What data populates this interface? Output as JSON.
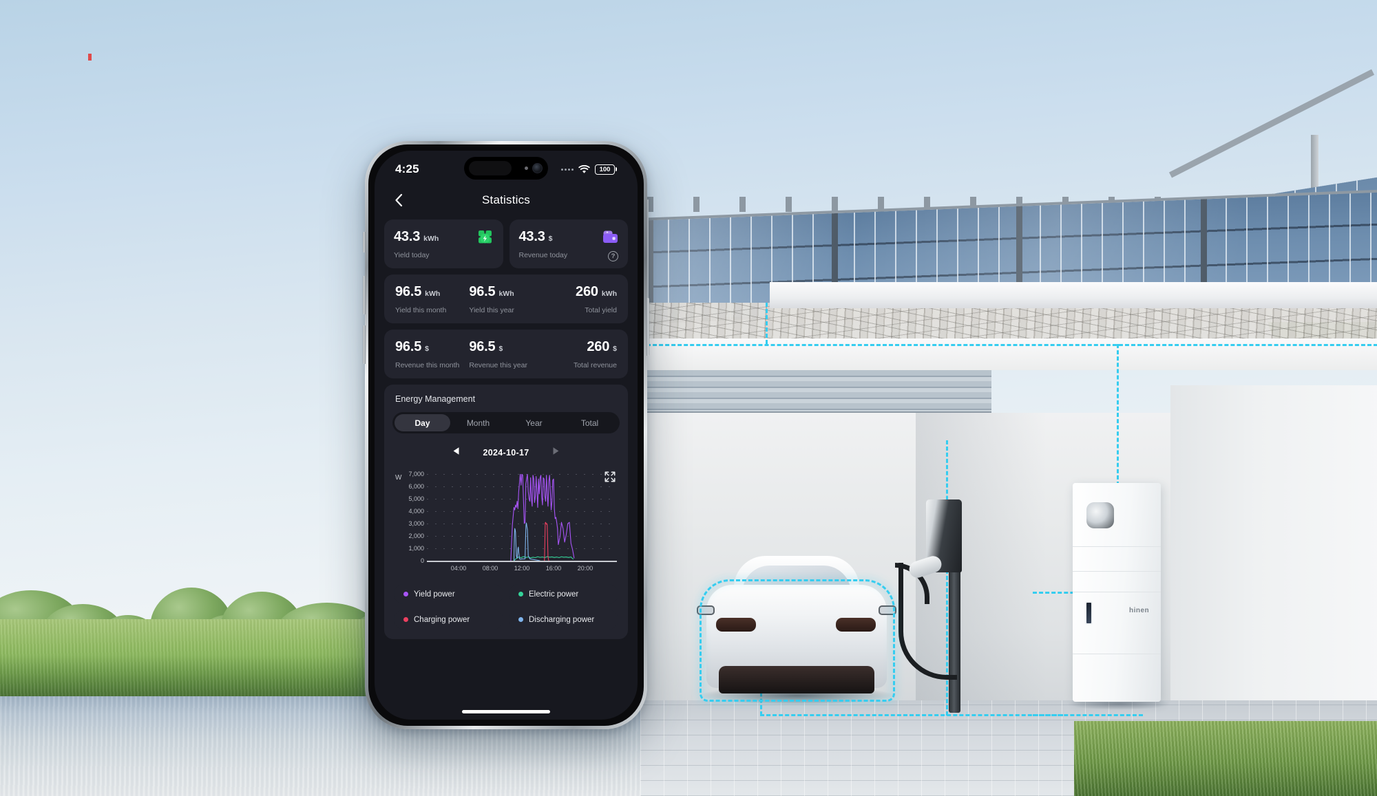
{
  "scene": {
    "battery_brand": "hinen"
  },
  "phone": {
    "statusbar": {
      "time": "4:25",
      "battery_level": "100",
      "wifi_icon": "wifi-icon",
      "signal_icon": "signal-dots-icon"
    },
    "nav": {
      "back_icon": "chevron-left-icon",
      "title": "Statistics"
    },
    "home_indicator": "home-indicator"
  },
  "stats": {
    "today": [
      {
        "value": "43.3",
        "unit": "kWh",
        "label": "Yield today",
        "icon": "solar-panel-icon",
        "icon_color": "#22c55e"
      },
      {
        "value": "43.3",
        "unit": "$",
        "label": "Revenue today",
        "icon": "wallet-icon",
        "icon_color": "#8b5cf6",
        "help": "?"
      }
    ],
    "yield_row": [
      {
        "value": "96.5",
        "unit": "kWh",
        "label": "Yield this month"
      },
      {
        "value": "96.5",
        "unit": "kWh",
        "label": "Yield this year"
      },
      {
        "value": "260",
        "unit": "kWh",
        "label": "Total yield"
      }
    ],
    "revenue_row": [
      {
        "value": "96.5",
        "unit": "$",
        "label": "Revenue this month"
      },
      {
        "value": "96.5",
        "unit": "$",
        "label": "Revenue this year"
      },
      {
        "value": "260",
        "unit": "$",
        "label": "Total revenue"
      }
    ]
  },
  "energy": {
    "title": "Energy Management",
    "tabs": [
      {
        "label": "Day",
        "active": true
      },
      {
        "label": "Month",
        "active": false
      },
      {
        "label": "Year",
        "active": false
      },
      {
        "label": "Total",
        "active": false
      }
    ],
    "date": "2024-10-17",
    "prev_icon": "triangle-left-icon",
    "next_icon": "triangle-right-icon",
    "expand_icon": "expand-fullscreen-icon",
    "legend": [
      {
        "label": "Yield power",
        "color": "#a855f7"
      },
      {
        "label": "Electric power",
        "color": "#34d399"
      },
      {
        "label": "Charging power",
        "color": "#ec4060"
      },
      {
        "label": "Discharging power",
        "color": "#7fb4ec"
      }
    ]
  },
  "chart_data": {
    "type": "line",
    "title": "",
    "xlabel": "",
    "ylabel": "W",
    "unit": "W",
    "ylim": [
      0,
      7000
    ],
    "yticks": [
      0,
      1000,
      2000,
      3000,
      4000,
      5000,
      6000,
      7000
    ],
    "ytick_labels": [
      "0",
      "1,000",
      "2,000",
      "3,000",
      "4,000",
      "5,000",
      "6,000",
      "7,000"
    ],
    "xlim": [
      0,
      24
    ],
    "xticks": [
      4,
      8,
      12,
      16,
      20
    ],
    "xtick_labels": [
      "04:00",
      "08:00",
      "12:00",
      "16:00",
      "20:00"
    ],
    "grid": true,
    "legend_position": "below",
    "series": [
      {
        "name": "Yield power",
        "color": "#a855f7",
        "x": [
          10.6,
          10.8,
          11.0,
          11.1,
          11.2,
          11.3,
          11.4,
          11.5,
          11.6,
          11.7,
          11.8,
          11.9,
          12.0,
          12.1,
          12.2,
          12.3,
          12.4,
          12.5,
          12.6,
          12.7,
          12.8,
          12.9,
          13.0,
          13.1,
          13.2,
          13.3,
          13.4,
          13.5,
          13.6,
          13.7,
          13.8,
          13.9,
          14.0,
          14.1,
          14.2,
          14.3,
          14.4,
          14.5,
          14.6,
          14.7,
          14.8,
          14.9,
          15.0,
          15.1,
          15.2,
          15.3,
          15.4,
          15.5,
          15.6,
          15.7,
          15.8,
          15.9,
          16.0,
          16.1,
          16.2,
          16.3,
          16.4,
          16.5,
          16.6,
          16.8,
          17.0,
          17.2,
          17.4,
          17.6,
          17.8,
          18.0,
          18.2,
          18.4,
          18.6
        ],
        "y": [
          0,
          2900,
          4300,
          4100,
          4500,
          4300,
          4800,
          4200,
          5600,
          6300,
          7050,
          6100,
          7000,
          6900,
          4900,
          3000,
          3100,
          6200,
          6600,
          7000,
          5600,
          5000,
          4800,
          6700,
          5000,
          4400,
          6900,
          6600,
          4700,
          5200,
          6800,
          5500,
          4300,
          6600,
          5400,
          6700,
          6900,
          5200,
          4500,
          6700,
          6600,
          5200,
          4800,
          6900,
          5300,
          4400,
          6400,
          6900,
          5500,
          4100,
          4800,
          6500,
          6600,
          4200,
          3400,
          3500,
          3100,
          2600,
          1300,
          1900,
          3100,
          2600,
          1500,
          2100,
          3000,
          3100,
          1400,
          900,
          200
        ]
      },
      {
        "name": "Electric power",
        "color": "#34d399",
        "x": [
          11.0,
          11.3,
          11.6,
          11.9,
          12.2,
          12.5,
          12.8,
          13.1,
          13.4,
          13.7,
          14.0,
          14.3,
          14.6,
          14.9,
          15.2,
          15.5,
          15.8,
          16.1,
          16.4,
          16.7,
          17.0,
          17.3,
          17.6,
          17.9,
          18.2,
          18.5
        ],
        "y": [
          0,
          190,
          300,
          240,
          330,
          260,
          300,
          230,
          280,
          250,
          320,
          270,
          300,
          250,
          330,
          280,
          310,
          260,
          300,
          250,
          320,
          280,
          300,
          260,
          300,
          120
        ]
      },
      {
        "name": "Charging power",
        "color": "#ec4060",
        "x": [
          14.85,
          14.9,
          14.95,
          15.0,
          15.05,
          15.1,
          15.15,
          15.2,
          15.25,
          15.3,
          15.4
        ],
        "y": [
          0,
          1400,
          3050,
          3100,
          3000,
          2950,
          3000,
          2900,
          1500,
          300,
          0
        ]
      },
      {
        "name": "Discharging power",
        "color": "#7fb4ec",
        "x": [
          11.0,
          11.05,
          11.1,
          11.15,
          11.2,
          11.3,
          11.4,
          11.5,
          11.55,
          11.6,
          11.7,
          11.8,
          11.9,
          12.0,
          12.4,
          12.5,
          12.55,
          12.6,
          12.7,
          12.8,
          13.0,
          14.3
        ],
        "y": [
          0,
          1800,
          2600,
          2500,
          2300,
          400,
          200,
          1000,
          1100,
          700,
          150,
          120,
          130,
          140,
          150,
          2700,
          3050,
          2900,
          2500,
          400,
          150,
          0
        ]
      }
    ]
  }
}
